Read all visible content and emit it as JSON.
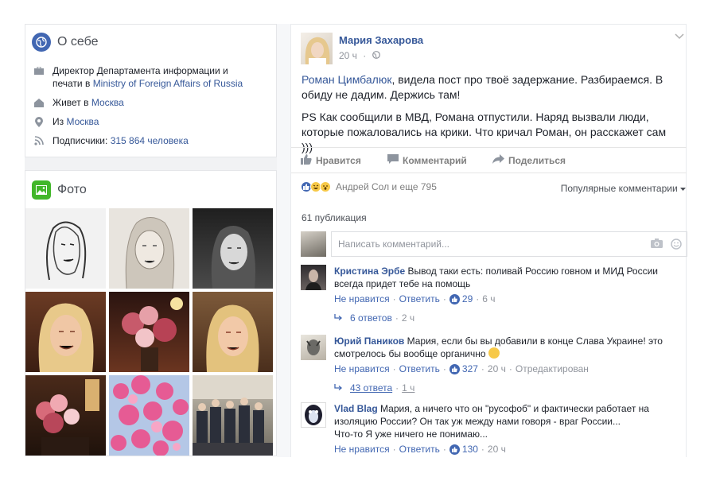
{
  "about": {
    "title": "О себе",
    "job_prefix": "Директор Департамента информации и печати в ",
    "job_link": "Ministry of Foreign Affairs of Russia",
    "lives_prefix": "Живет в ",
    "lives_link": "Москва",
    "from_prefix": "Из ",
    "from_link": "Москва",
    "followers_prefix": "Подписчики: ",
    "followers_link": "315 864 человека"
  },
  "photos": {
    "title": "Фото"
  },
  "post": {
    "author": "Мария Захарова",
    "time": "20 ч",
    "mention": "Роман Цимбалюк",
    "text1_rest": ", видела пост про твоё задержание. Разбираемся. В обиду не дадим. Держись там!",
    "text2": "PS Как сообщили в МВД, Романа отпустили. Наряд вызвали люди, которые пожаловались на крики. Что кричал Роман, он расскажет сам )))",
    "like_label": "Нравится",
    "comment_label": "Комментарий",
    "share_label": "Поделиться",
    "reactions_text": "Андрей Сол и еще 795",
    "sort_label": "Популярные комментарии",
    "publications": "61 публикация",
    "comment_placeholder": "Написать комментарий..."
  },
  "comments": [
    {
      "name": "Кристина Эрбе",
      "text": " Вывод таки есть: поливай Россию говном и МИД России всегда придет тебе на помощь",
      "unlike": "Не нравится",
      "reply": "Ответить",
      "likes": "29",
      "time": "6 ч",
      "replies": "6 ответов",
      "replies_time": "2 ч"
    },
    {
      "name": "Юрий Паников",
      "text": " Мария, если бы вы добавили в конце Слава Украине! это смотрелось бы вообще органично",
      "unlike": "Не нравится",
      "reply": "Ответить",
      "likes": "327",
      "time": "20 ч",
      "edited": "Отредактирован",
      "replies": "43 ответа",
      "replies_time": "1 ч"
    },
    {
      "name": "Vlad Blag",
      "text": " Мария, а ничего что он \"русофоб\" и фактически работает на изоляцию России? Он так уж между нами говоря - враг России...",
      "text2": "Что-то Я уже ничего не понимаю...",
      "unlike": "Не нравится",
      "reply": "Ответить",
      "likes": "130",
      "time": "20 ч"
    }
  ],
  "colors": {
    "link": "#365899",
    "accent": "#4267b2",
    "meta": "#90949c"
  }
}
